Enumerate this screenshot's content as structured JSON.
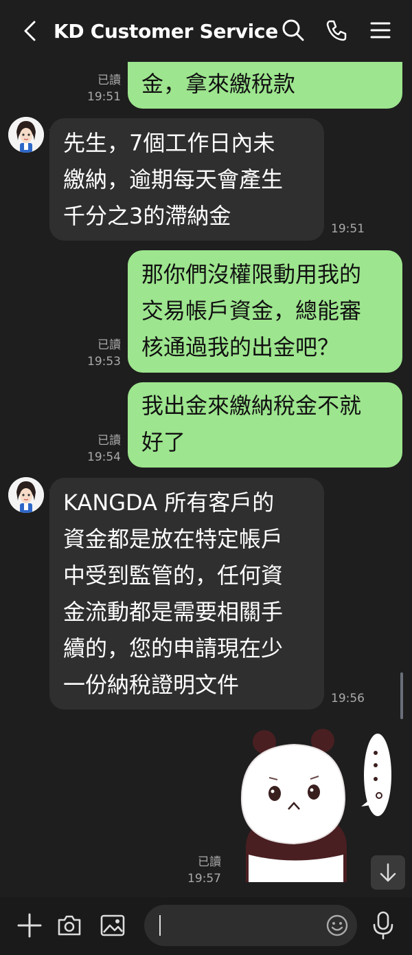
{
  "header": {
    "title": "KD Customer Service",
    "icons": [
      "back-arrow-icon",
      "search-icon",
      "phone-icon",
      "menu-icon"
    ]
  },
  "messages": [
    {
      "side": "out",
      "text": "金，拿來繳稅款",
      "read": "已讀",
      "time": "19:51"
    },
    {
      "side": "in",
      "text": "先生，7個工作日內未\n繳納，逾期每天會產生\n千分之3的滯納金",
      "time": "19:51"
    },
    {
      "side": "out",
      "text": "那你們沒權限動用我的\n交易帳戶資金，總能審\n核通過我的出金吧？",
      "read": "已讀",
      "time": "19:53"
    },
    {
      "side": "out",
      "text": "我出金來繳納稅金不就\n好了",
      "read": "已讀",
      "time": "19:54"
    },
    {
      "side": "in",
      "text": "KANGDA 所有客戶的\n資金都是放在特定帳戶\n中受到監管的，任何資\n金流動都是需要相關手\n續的，您的申請現在少\n一份納稅證明文件",
      "time": "19:56"
    },
    {
      "side": "out",
      "type": "sticker",
      "sticker": "panda-sticker",
      "read": "已讀",
      "time": "19:57"
    }
  ],
  "footer": {
    "icons": [
      "plus-icon",
      "camera-icon",
      "image-icon",
      "emoji-icon",
      "microphone-icon"
    ],
    "input_placeholder": ""
  },
  "colors": {
    "background": "#1e1e1e",
    "outgoing_bubble": "#9de58e",
    "incoming_bubble": "#2f2f2f"
  }
}
